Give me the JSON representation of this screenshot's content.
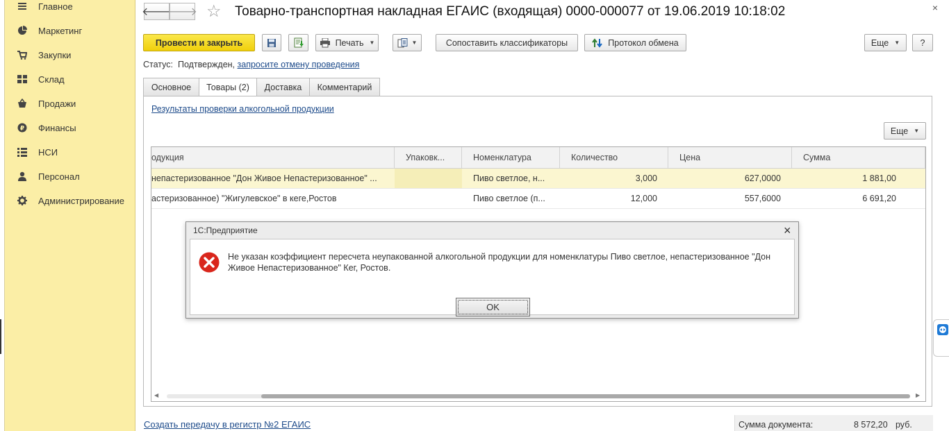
{
  "sidebar": {
    "items": [
      {
        "label": "Главное",
        "icon": "menu-icon"
      },
      {
        "label": "Маркетинг",
        "icon": "pie-chart-icon"
      },
      {
        "label": "Закупки",
        "icon": "cart-icon"
      },
      {
        "label": "Склад",
        "icon": "grid-icon"
      },
      {
        "label": "Продажи",
        "icon": "basket-icon"
      },
      {
        "label": "Финансы",
        "icon": "ruble-icon"
      },
      {
        "label": "НСИ",
        "icon": "list-icon"
      },
      {
        "label": "Персонал",
        "icon": "person-icon"
      },
      {
        "label": "Администрирование",
        "icon": "gear-icon"
      }
    ]
  },
  "header": {
    "back": "🡐",
    "forward": "🡒",
    "star": "☆",
    "title": "Товарно-транспортная накладная ЕГАИС (входящая) 0000-000077 от 19.06.2019 10:18:02",
    "close": "×"
  },
  "toolbar": {
    "post_close": "Провести и закрыть",
    "print": "Печать",
    "match": "Сопоставить классификаторы",
    "protocol": "Протокол обмена",
    "more": "Еще",
    "help": "?"
  },
  "status": {
    "label": "Статус:",
    "value": "Подтвержден,",
    "link": "запросите отмену проведения"
  },
  "tabs": [
    {
      "label": "Основное"
    },
    {
      "label": "Товары (2)"
    },
    {
      "label": "Доставка"
    },
    {
      "label": "Комментарий"
    }
  ],
  "goods": {
    "check_link": "Результаты проверки алкогольной продукции",
    "more": "Еще",
    "columns": [
      "одукция",
      "Упаковк...",
      "Номенклатура",
      "Количество",
      "Цена",
      "Сумма"
    ],
    "rows": [
      [
        "непастеризованное \"Дон Живое Непастеризованное\" ...",
        "",
        "Пиво светлое, н...",
        "3,000",
        "627,0000",
        "1 881,00"
      ],
      [
        "астеризованное) \"Жигулевское\" в кеге,Ростов",
        "",
        "Пиво светлое (п...",
        "12,000",
        "557,6000",
        "6 691,20"
      ]
    ]
  },
  "dialog": {
    "title": "1С:Предприятие",
    "close": "×",
    "message": "Не указан коэффициент пересчета неупакованной алкогольной продукции для номенклатуры Пиво светлое, непастеризованное \"Дон Живое Непастеризованное\" Кег, Ростов.",
    "ok": "OK"
  },
  "footer": {
    "link": "Создать передачу в регистр №2 ЕГАИС",
    "sum_label": "Сумма документа:",
    "sum_value": "8 572,20",
    "currency": "руб."
  },
  "colors": {
    "sidebar_bg": "#fbeea6",
    "primary_button": "#f5d823",
    "link": "#1c4a8a",
    "error": "#d9261c"
  }
}
